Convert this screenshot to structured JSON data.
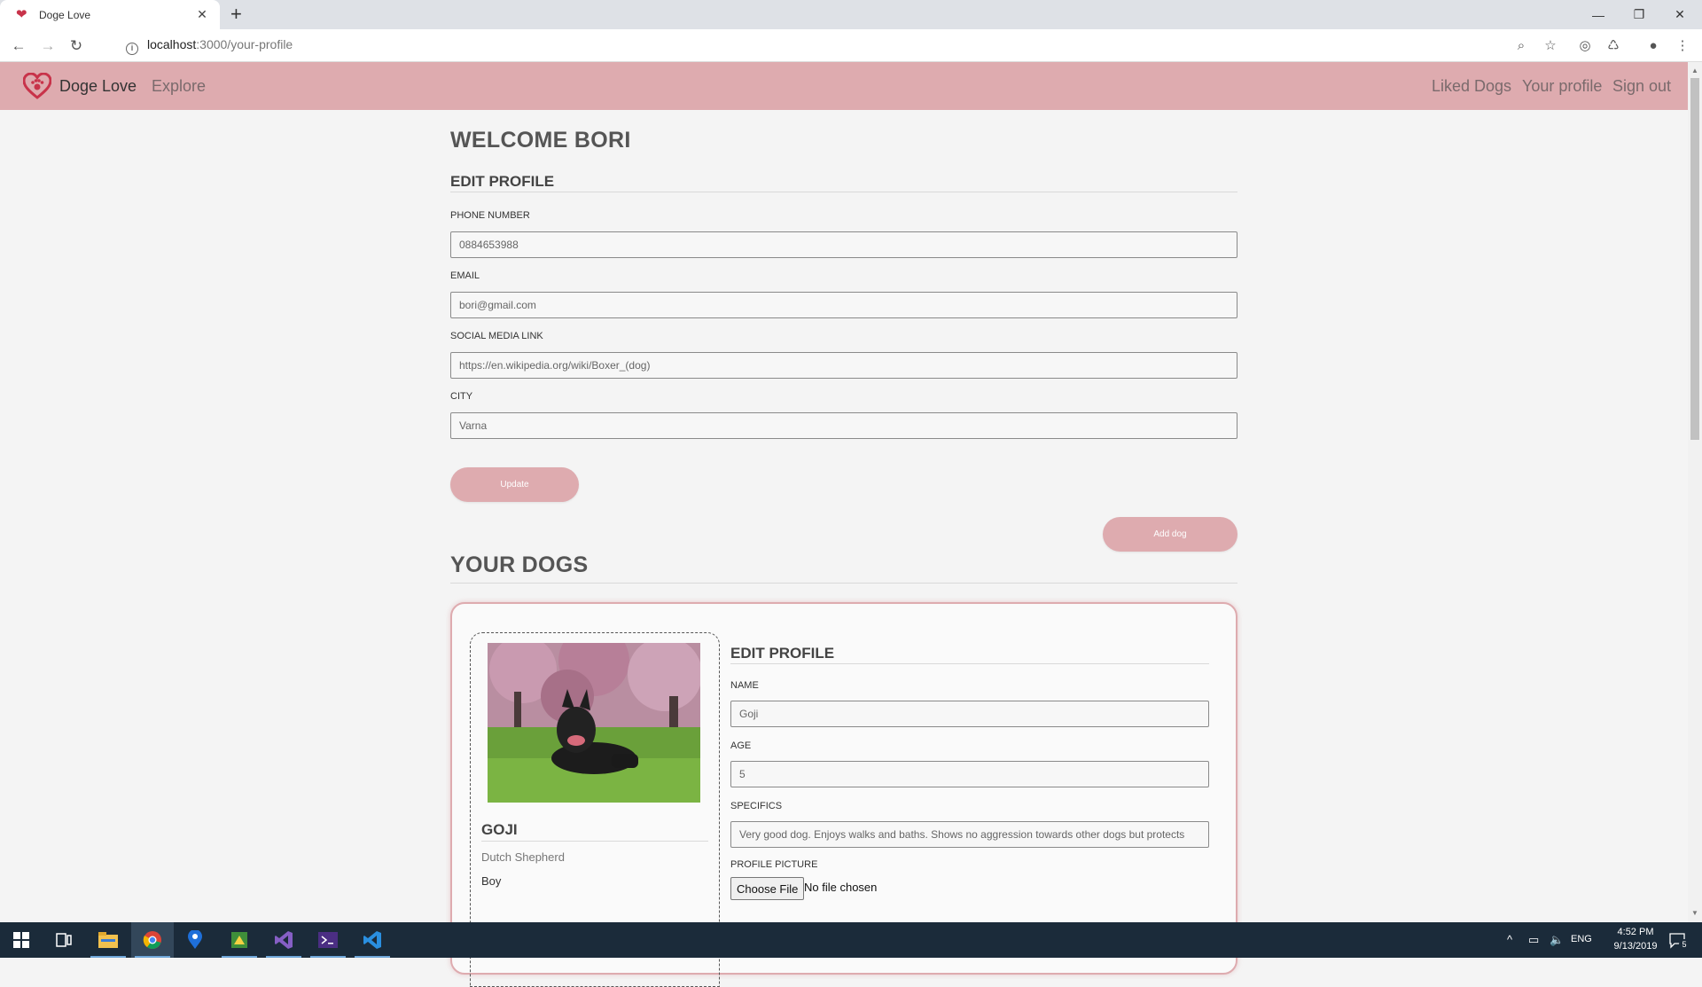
{
  "browser": {
    "tab_title": "Doge Love",
    "url_host": "localhost",
    "url_path": ":3000/your-profile"
  },
  "site": {
    "brand": "Doge Love",
    "nav_left": [
      "Explore"
    ],
    "nav_right": [
      "Liked Dogs",
      "Your profile",
      "Sign out"
    ],
    "accent_color": "#deabaf"
  },
  "profile": {
    "welcome": "WELCOME BORI",
    "section_title": "EDIT PROFILE",
    "fields": [
      {
        "label": "PHONE NUMBER",
        "value": "0884653988"
      },
      {
        "label": "EMAIL",
        "value": "bori@gmail.com"
      },
      {
        "label": "SOCIAL MEDIA LINK",
        "value": "https://en.wikipedia.org/wiki/Boxer_(dog)"
      },
      {
        "label": "CITY",
        "value": "Varna"
      }
    ],
    "update_button": "Update",
    "add_dog_button": "Add dog"
  },
  "dogs": {
    "title": "YOUR DOGS",
    "items": [
      {
        "name": "GOJI",
        "breed": "Dutch Shepherd",
        "gender": "Boy",
        "edit_title": "EDIT PROFILE",
        "fields": [
          {
            "label": "NAME",
            "value": "Goji"
          },
          {
            "label": "AGE",
            "value": "5"
          },
          {
            "label": "SPECIFICS",
            "value": "Very good dog. Enjoys walks and baths. Shows no aggression towards other dogs but protects"
          }
        ],
        "picture_label": "PROFILE PICTURE",
        "file_button": "Choose File",
        "file_status": "No file chosen"
      }
    ]
  },
  "taskbar": {
    "language": "ENG",
    "time": "4:52 PM",
    "date": "9/13/2019",
    "notifications": "5"
  }
}
